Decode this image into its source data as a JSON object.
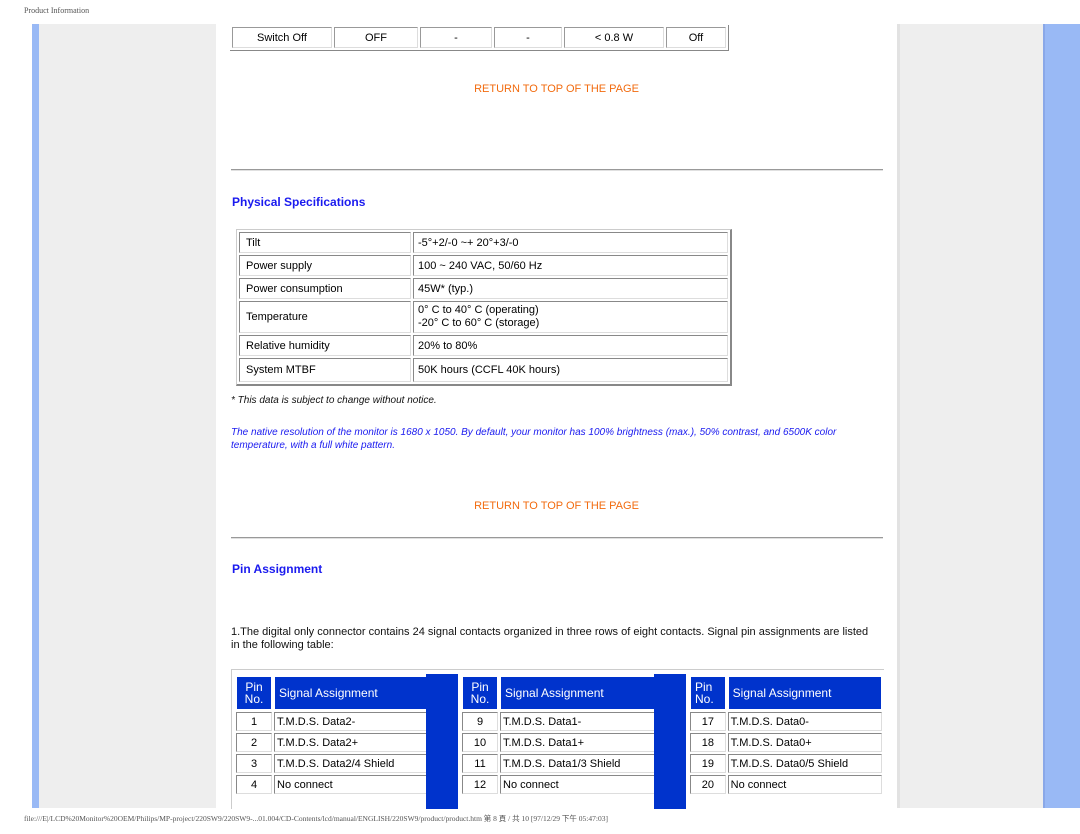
{
  "print_header": "Product Information",
  "print_footer": "file:///E|/LCD%20Monitor%20OEM/Philips/MP-project/220SW9/220SW9-...01.004/CD-Contents/lcd/manual/ENGLISH/220SW9/product/product.htm 第 8 頁 / 共 10  [97/12/29 下午 05:47:03]",
  "power_row": [
    "Switch Off",
    "OFF",
    "-",
    "-",
    "< 0.8 W",
    "Off"
  ],
  "return_link": "RETURN TO TOP OF THE PAGE",
  "physical": {
    "title": "Physical Specifications",
    "rows": [
      {
        "label": "Tilt",
        "value": "-5°+2/-0 ~+ 20°+3/-0",
        "value2": ""
      },
      {
        "label": "Power supply",
        "value": "100 ~ 240 VAC, 50/60 Hz",
        "value2": ""
      },
      {
        "label": "Power consumption",
        "value": "45W* (typ.)",
        "value2": ""
      },
      {
        "label": "Temperature",
        "value": "0° C to 40° C (operating)",
        "value2": "-20° C to 60° C (storage)"
      },
      {
        "label": "Relative humidity",
        "value": "20% to 80%",
        "value2": ""
      },
      {
        "label": "System MTBF",
        "value": "50K hours (CCFL 40K hours)",
        "value2": ""
      }
    ],
    "note": "* This data is subject to change without notice.",
    "native_note": "The native resolution of the monitor is 1680 x 1050. By default, your monitor has 100% brightness (max.), 50% contrast, and 6500K color temperature, with a full white pattern."
  },
  "pins": {
    "title": "Pin Assignment",
    "intro": "1.The digital only connector contains 24 signal contacts organized in three rows of eight contacts. Signal pin assignments are listed in the following table:",
    "header_no": "Pin No.",
    "header_signal": "Signal Assignment",
    "groups": [
      [
        {
          "no": "1",
          "signal": "T.M.D.S. Data2-"
        },
        {
          "no": "2",
          "signal": "T.M.D.S. Data2+"
        },
        {
          "no": "3",
          "signal": "T.M.D.S. Data2/4 Shield"
        },
        {
          "no": "4",
          "signal": "No connect"
        }
      ],
      [
        {
          "no": "9",
          "signal": "T.M.D.S. Data1-"
        },
        {
          "no": "10",
          "signal": "T.M.D.S. Data1+"
        },
        {
          "no": "11",
          "signal": "T.M.D.S. Data1/3 Shield"
        },
        {
          "no": "12",
          "signal": "No connect"
        }
      ],
      [
        {
          "no": "17",
          "signal": "T.M.D.S. Data0-"
        },
        {
          "no": "18",
          "signal": "T.M.D.S. Data0+"
        },
        {
          "no": "19",
          "signal": "T.M.D.S. Data0/5 Shield"
        },
        {
          "no": "20",
          "signal": "No connect"
        }
      ]
    ]
  }
}
